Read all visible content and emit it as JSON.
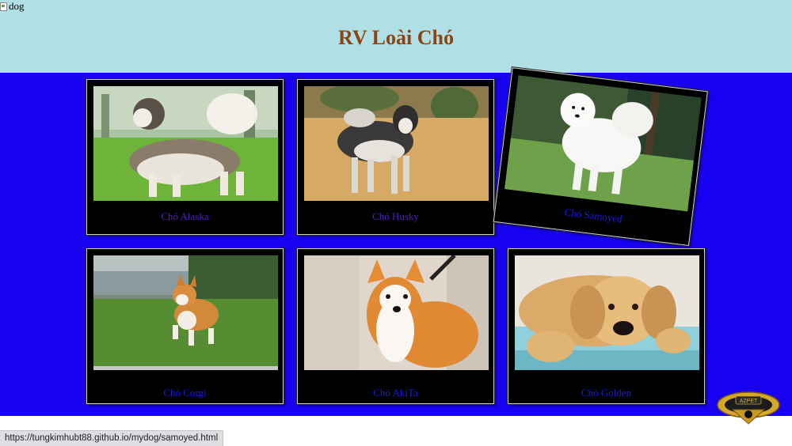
{
  "broken_image": {
    "alt": "dog"
  },
  "header": {
    "title": "RV Loài Chó",
    "background": "#b0e0e6",
    "title_color": "#8b4513"
  },
  "main": {
    "background": "#1800f0"
  },
  "cards": [
    {
      "label": "Chó Alaska"
    },
    {
      "label": "Chó Husky"
    },
    {
      "label": "Chó Samoyed"
    },
    {
      "label": "Chó Corgi"
    },
    {
      "label": "Chó AkiTa"
    },
    {
      "label": "Chó Golden"
    }
  ],
  "logo": {
    "text": "AZPET"
  },
  "status_bar": {
    "url": "https://tungkimhubt88.github.io/mydog/samoyed.html"
  }
}
